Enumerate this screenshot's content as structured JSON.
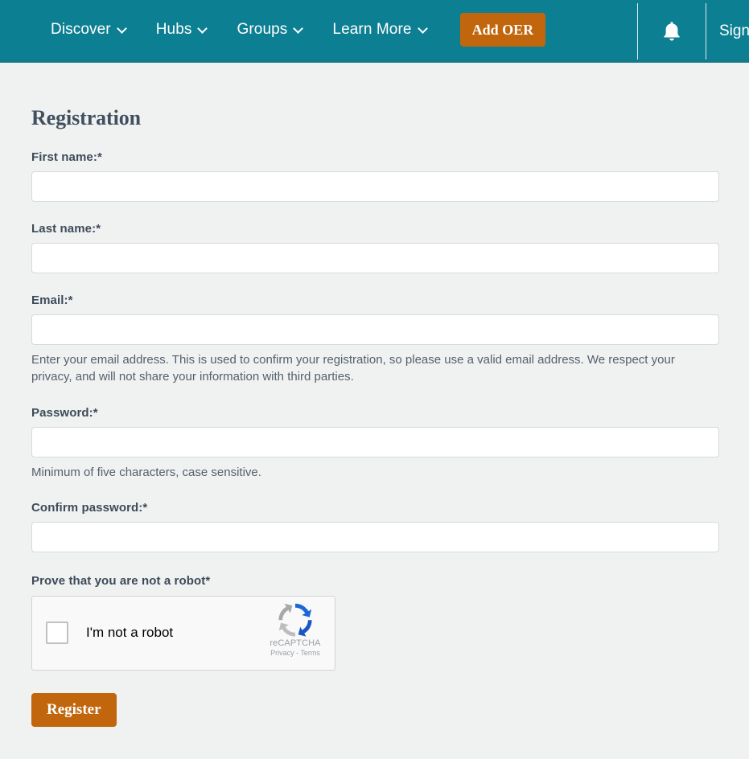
{
  "colors": {
    "navbar_teal": "#0d7f92",
    "navbar_bottom_strip": "#15798a",
    "accent_orange": "#c1660c",
    "page_background": "#f0f1f1",
    "heading_text": "#41505e",
    "label_text": "#3d4b59",
    "help_text": "#53616d",
    "input_border": "#d7d9da",
    "recaptcha_blue": "#1c69d4",
    "recaptcha_gray": "#bdbdbd"
  },
  "navbar": {
    "items": [
      {
        "label": "Discover",
        "icon": "chevron-down-icon",
        "has_dropdown": true
      },
      {
        "label": "Hubs",
        "icon": "chevron-down-icon",
        "has_dropdown": true
      },
      {
        "label": "Groups",
        "icon": "chevron-down-icon",
        "has_dropdown": true
      },
      {
        "label": "Learn More",
        "icon": "chevron-down-icon",
        "has_dropdown": true
      }
    ],
    "add_oer_label": "Add OER",
    "notification_icon": "bell-icon",
    "signin_label": "Sign"
  },
  "page": {
    "title": "Registration"
  },
  "form": {
    "fields": [
      {
        "label": "First name:*",
        "name": "first-name",
        "type": "text",
        "value": "",
        "placeholder": "",
        "help": ""
      },
      {
        "label": "Last name:*",
        "name": "last-name",
        "type": "text",
        "value": "",
        "placeholder": "",
        "help": ""
      },
      {
        "label": "Email:*",
        "name": "email",
        "type": "text",
        "value": "",
        "placeholder": "",
        "help": "Enter your email address. This is used to confirm your registration, so please use a valid email address. We respect your privacy, and will not share your information with third parties."
      },
      {
        "label": "Password:*",
        "name": "password",
        "type": "password",
        "value": "",
        "placeholder": "",
        "help": "Minimum of five characters, case sensitive."
      },
      {
        "label": "Confirm password:*",
        "name": "confirm-password",
        "type": "password",
        "value": "",
        "placeholder": "",
        "help": ""
      }
    ],
    "captcha": {
      "label": "Prove that you are not a robot*",
      "checkbox_label": "I'm not a robot",
      "brand": "reCAPTCHA",
      "legal": "Privacy - Terms",
      "logo_icon": "recaptcha-logo-icon"
    },
    "submit_label": "Register"
  }
}
